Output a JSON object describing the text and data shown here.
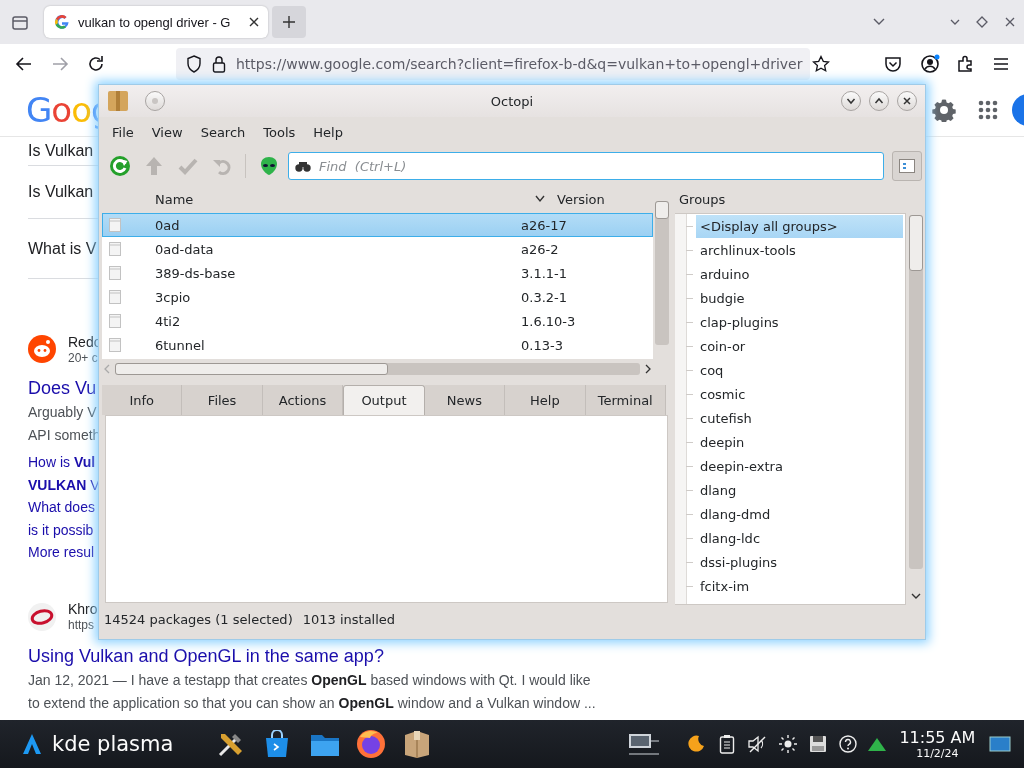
{
  "browser": {
    "tab_title": "vulkan to opengl driver - G",
    "url": "https://www.google.com/search?client=firefox-b-d&q=vulkan+to+opengl+driver"
  },
  "google": {
    "logo": "Goog",
    "questions": [
      "Is Vulkan",
      "Is Vulkan",
      "What is V"
    ],
    "results": [
      {
        "source": "Redc",
        "meta": "20+ c",
        "title": "Does Vu",
        "snippet": [
          "Arguably V",
          "API someth"
        ],
        "links": [
          "How is **Vul**",
          "**VULKAN** V",
          "What does",
          "is it possib",
          "More resul"
        ]
      },
      {
        "source": "Khro",
        "meta": "https",
        "title": "Using Vulkan and OpenGL in the same app?",
        "snippet": [
          "Jan 12, 2021 — I have a testapp that creates **OpenGL** based windows with Qt. I would like",
          "to extend the application so that you can show an **OpenGL** window and a Vulkan window ..."
        ]
      }
    ]
  },
  "octopi": {
    "title": "Octopi",
    "menu": [
      "File",
      "View",
      "Search",
      "Tools",
      "Help"
    ],
    "toolbar": [
      {
        "kind": "sync",
        "disabled": false
      },
      {
        "kind": "upgrade",
        "disabled": true
      },
      {
        "kind": "commit",
        "disabled": true
      },
      {
        "kind": "rollback",
        "disabled": true
      },
      {
        "kind": "aur",
        "disabled": false
      }
    ],
    "search": {
      "placeholder": "Find  (Ctrl+L)"
    },
    "columns": [
      "Name",
      "Version"
    ],
    "packages": [
      {
        "name": "0ad",
        "version": "a26-17",
        "selected": true
      },
      {
        "name": "0ad-data",
        "version": "a26-2",
        "selected": false
      },
      {
        "name": "389-ds-base",
        "version": "3.1.1-1",
        "selected": false
      },
      {
        "name": "3cpio",
        "version": "0.3.2-1",
        "selected": false
      },
      {
        "name": "4ti2",
        "version": "1.6.10-3",
        "selected": false
      },
      {
        "name": "6tunnel",
        "version": "0.13-3",
        "selected": false
      }
    ],
    "tabs": [
      {
        "label": "Info",
        "selected": false
      },
      {
        "label": "Files",
        "selected": false
      },
      {
        "label": "Actions",
        "selected": false
      },
      {
        "label": "Output",
        "selected": true
      },
      {
        "label": "News",
        "selected": false
      },
      {
        "label": "Help",
        "selected": false
      },
      {
        "label": "Terminal",
        "selected": false
      }
    ],
    "groups_title": "Groups",
    "groups": [
      {
        "label": "<Display all groups>",
        "selected": true
      },
      {
        "label": "archlinux-tools",
        "selected": false
      },
      {
        "label": "arduino",
        "selected": false
      },
      {
        "label": "budgie",
        "selected": false
      },
      {
        "label": "clap-plugins",
        "selected": false
      },
      {
        "label": "coin-or",
        "selected": false
      },
      {
        "label": "coq",
        "selected": false
      },
      {
        "label": "cosmic",
        "selected": false
      },
      {
        "label": "cutefish",
        "selected": false
      },
      {
        "label": "deepin",
        "selected": false
      },
      {
        "label": "deepin-extra",
        "selected": false
      },
      {
        "label": "dlang",
        "selected": false
      },
      {
        "label": "dlang-dmd",
        "selected": false
      },
      {
        "label": "dlang-ldc",
        "selected": false
      },
      {
        "label": "dssi-plugins",
        "selected": false
      },
      {
        "label": "fcitx-im",
        "selected": false
      }
    ],
    "status": [
      "14524 packages (1 selected)",
      "1013 installed"
    ]
  },
  "taskbar": {
    "launcher": "kde plasma",
    "time": "11:55 AM",
    "date": "11/2/24"
  }
}
